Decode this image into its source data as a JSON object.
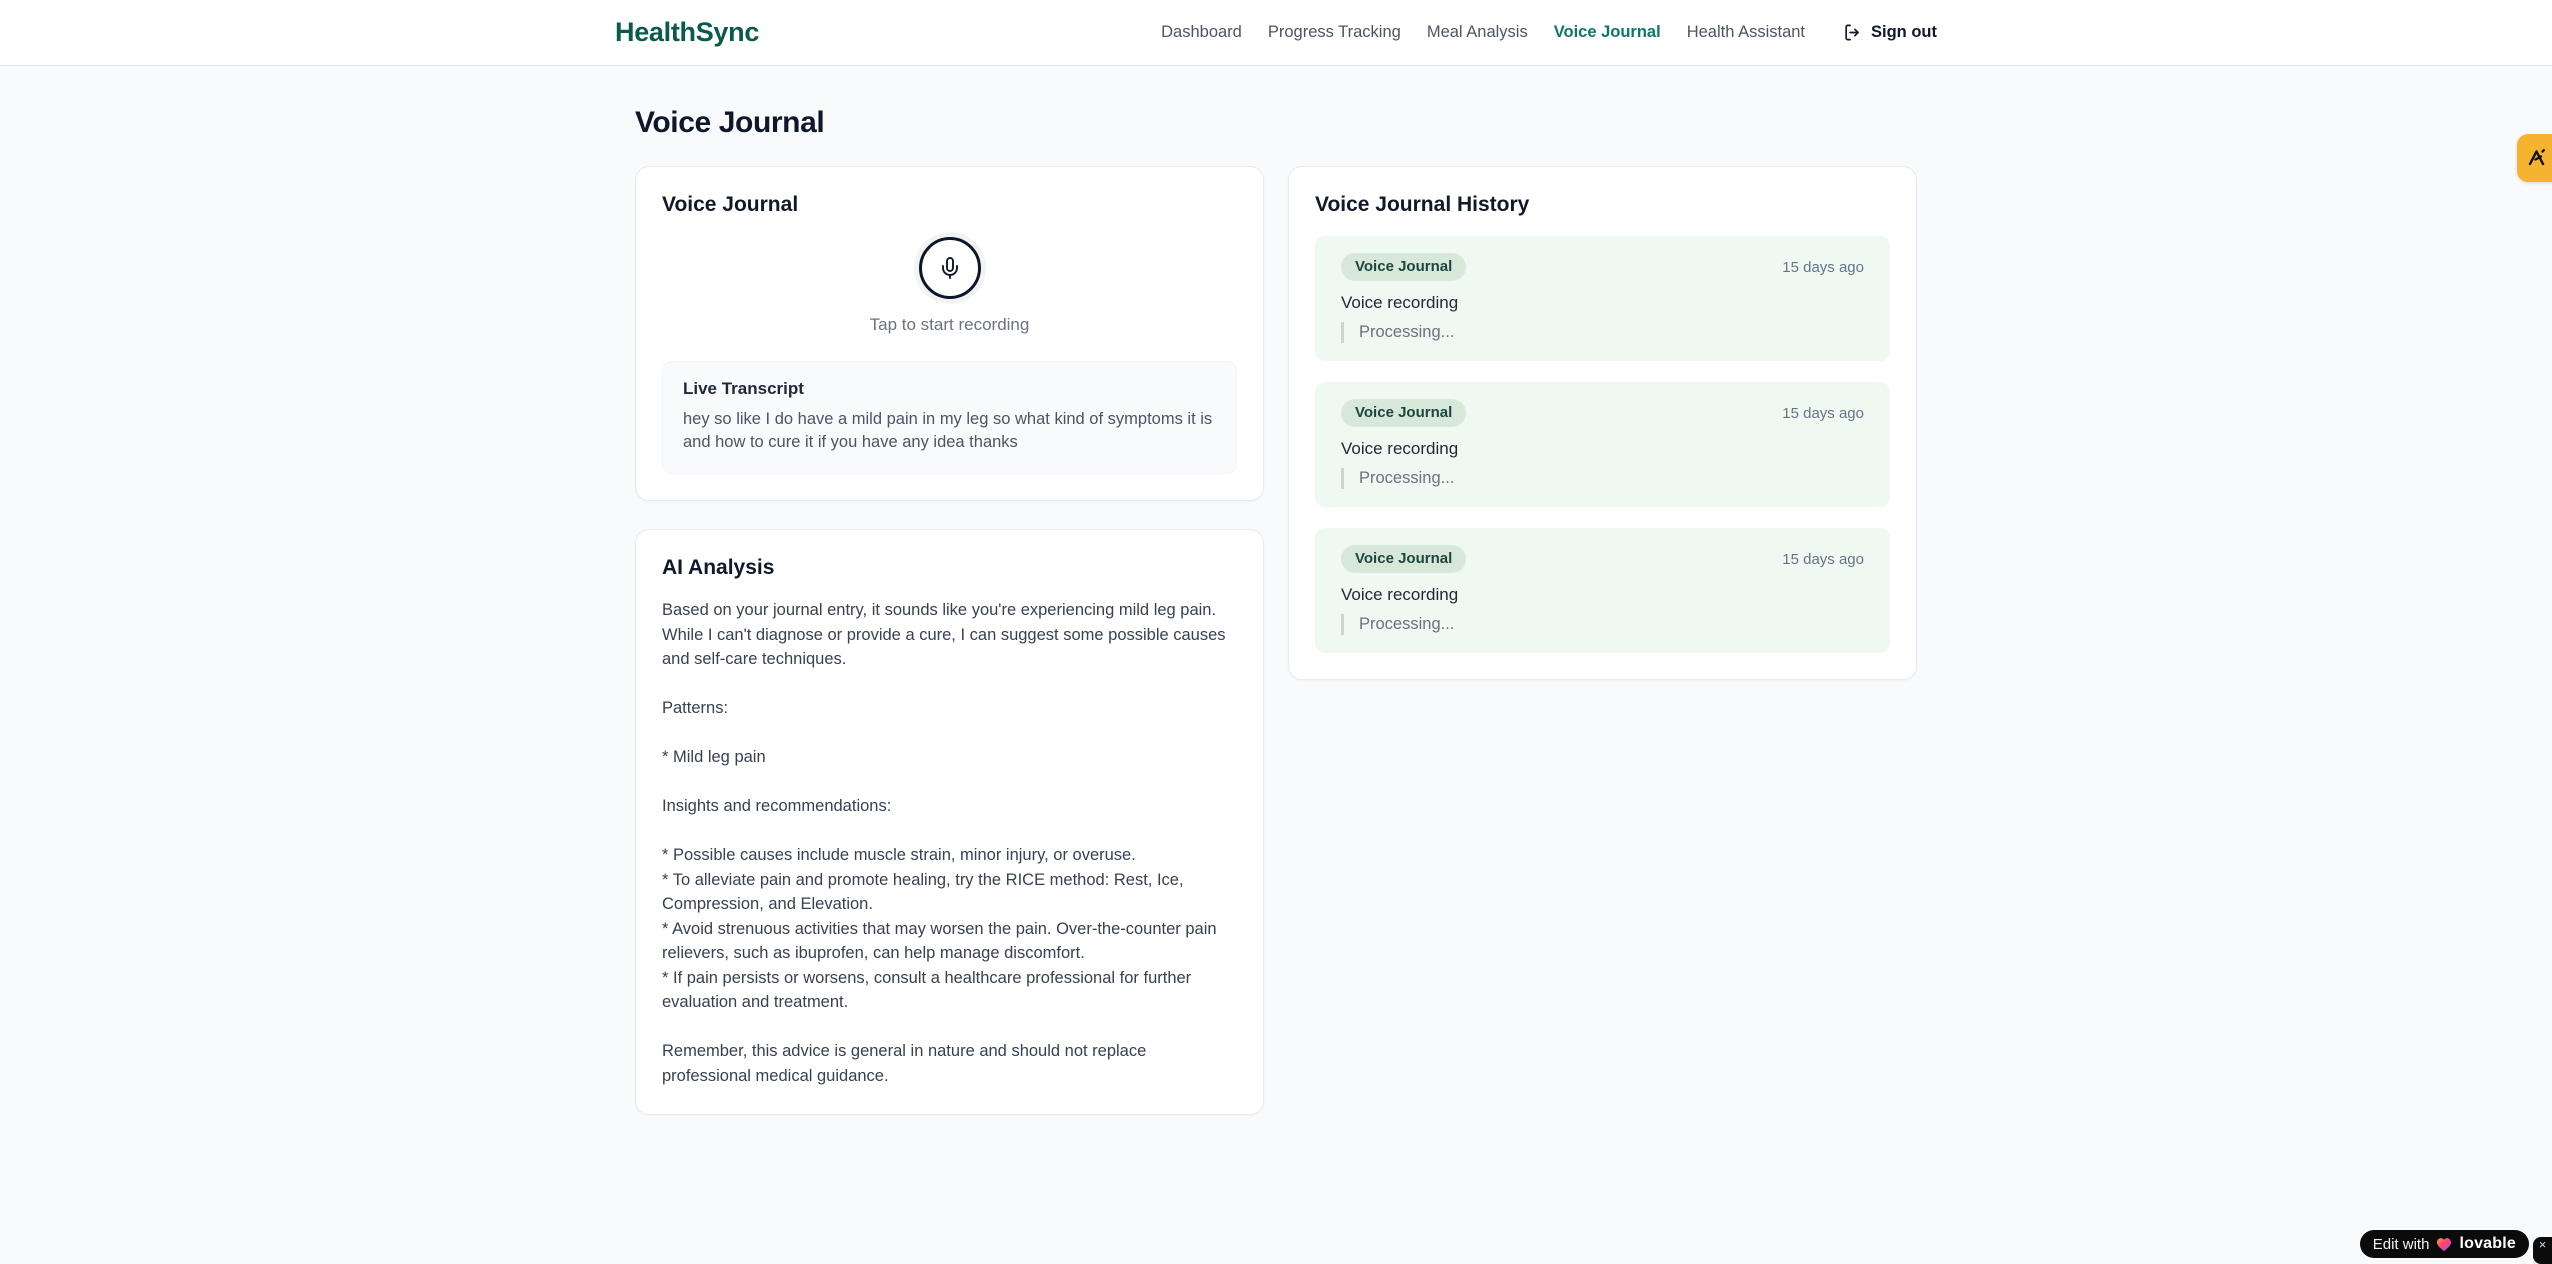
{
  "brand": {
    "name": "HealthSync"
  },
  "nav": {
    "items": [
      {
        "label": "Dashboard",
        "active": false
      },
      {
        "label": "Progress Tracking",
        "active": false
      },
      {
        "label": "Meal Analysis",
        "active": false
      },
      {
        "label": "Voice Journal",
        "active": true
      },
      {
        "label": "Health Assistant",
        "active": false
      }
    ],
    "sign_out_label": "Sign out"
  },
  "page": {
    "title": "Voice Journal"
  },
  "recorder_card": {
    "title": "Voice Journal",
    "tap_hint": "Tap to start recording",
    "transcript_title": "Live Transcript",
    "transcript_text": "hey so like I do have a mild pain in my leg so what kind of symptoms it is and how to cure it if you have any idea thanks"
  },
  "analysis_card": {
    "title": "AI Analysis",
    "body": "Based on your journal entry, it sounds like you're experiencing mild leg pain. While I can't diagnose or provide a cure, I can suggest some possible causes and self-care techniques.\n\nPatterns:\n\n* Mild leg pain\n\nInsights and recommendations:\n\n* Possible causes include muscle strain, minor injury, or overuse.\n* To alleviate pain and promote healing, try the RICE method: Rest, Ice, Compression, and Elevation.\n* Avoid strenuous activities that may worsen the pain. Over-the-counter pain relievers, such as ibuprofen, can help manage discomfort.\n* If pain persists or worsens, consult a healthcare professional for further evaluation and treatment.\n\nRemember, this advice is general in nature and should not replace professional medical guidance."
  },
  "history_card": {
    "title": "Voice Journal History",
    "entries": [
      {
        "badge": "Voice Journal",
        "time": "15 days ago",
        "label": "Voice recording",
        "status": "Processing..."
      },
      {
        "badge": "Voice Journal",
        "time": "15 days ago",
        "label": "Voice recording",
        "status": "Processing..."
      },
      {
        "badge": "Voice Journal",
        "time": "15 days ago",
        "label": "Voice recording",
        "status": "Processing..."
      }
    ]
  },
  "lovable_badge": {
    "edit_with": "Edit with",
    "brand": "lovable",
    "close": "×"
  },
  "icons": {
    "mic": "mic-icon",
    "sign_out": "log-out-icon",
    "extension_tab": "extension-a-logo-icon",
    "heart": "gradient-heart-icon"
  },
  "colors": {
    "brand_teal": "#0a5a4e",
    "active_nav_teal": "#0f766e",
    "nav_gray": "#4b5563",
    "page_background": "#f8fafc",
    "card_border": "#e7ebef",
    "history_entry_bg": "#eff8f1",
    "badge_bg": "#d7e8da",
    "badge_text": "#1c473e",
    "extension_tab_amber": "#f5b32f",
    "lovable_black": "#0b0b0c"
  }
}
